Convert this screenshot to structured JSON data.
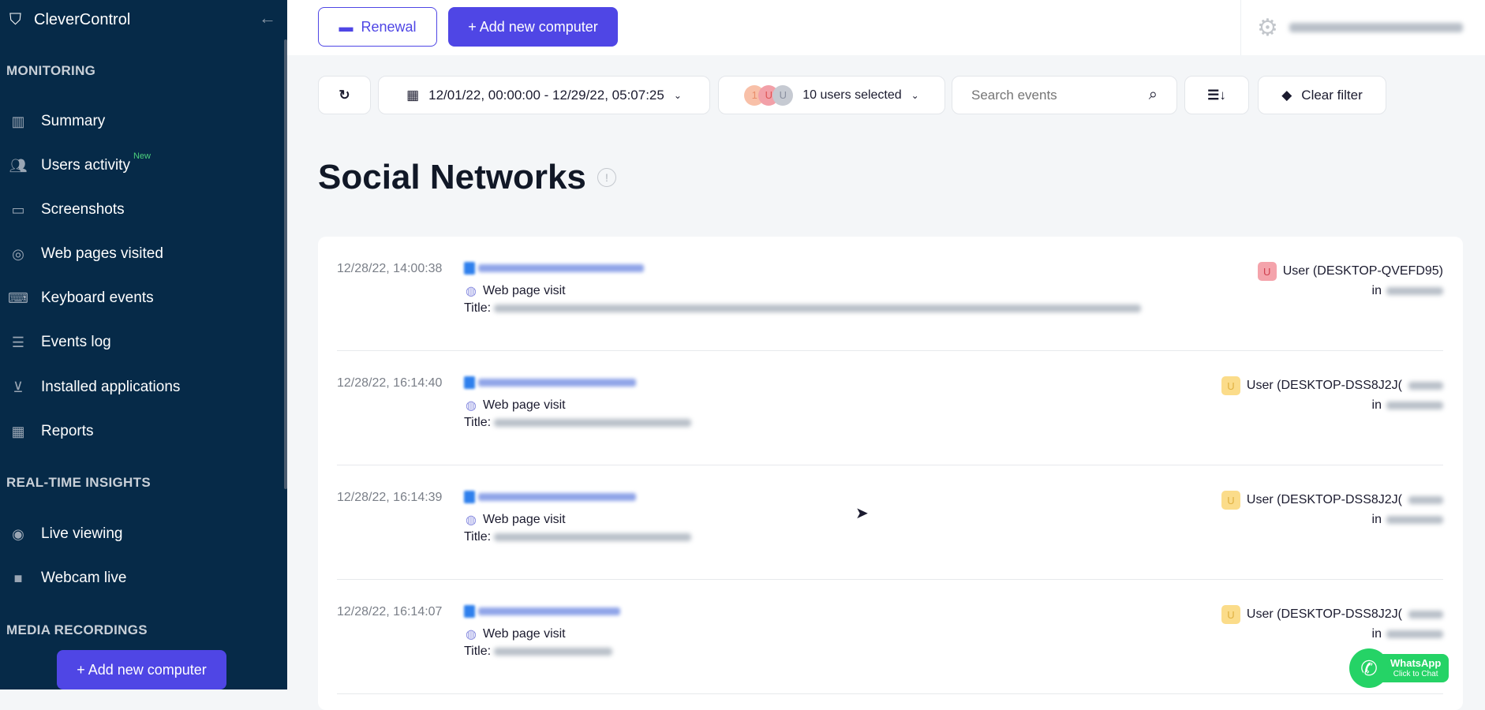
{
  "sidebar": {
    "brand": "CleverControl",
    "sections": {
      "monitoring": "MONITORING",
      "realtime": "REAL-TIME INSIGHTS",
      "media": "MEDIA RECORDINGS"
    },
    "items": [
      {
        "label": "Summary",
        "icon": "chart-icon"
      },
      {
        "label": "Users activity",
        "icon": "users-icon",
        "badge": "New"
      },
      {
        "label": "Screenshots",
        "icon": "monitor-icon"
      },
      {
        "label": "Web pages visited",
        "icon": "globe-icon"
      },
      {
        "label": "Keyboard events",
        "icon": "keyboard-icon"
      },
      {
        "label": "Events log",
        "icon": "list-icon"
      },
      {
        "label": "Installed applications",
        "icon": "install-icon"
      },
      {
        "label": "Reports",
        "icon": "grid-icon"
      },
      {
        "label": "Live viewing",
        "icon": "eye-icon"
      },
      {
        "label": "Webcam live",
        "icon": "camera-icon"
      }
    ],
    "add_button": "+ Add new computer"
  },
  "topbar": {
    "renewal": "Renewal",
    "add_computer": "+ Add new computer"
  },
  "filters": {
    "date_range": "12/01/22, 00:00:00 - 12/29/22, 05:07:25",
    "avatars": [
      "1",
      "U",
      "U"
    ],
    "users": "10 users selected",
    "search_placeholder": "Search events",
    "clear": "Clear filter"
  },
  "page": {
    "title": "Social Networks",
    "info": "!"
  },
  "events": [
    {
      "time": "12/28/22, 14:00:38",
      "type": "Web page visit",
      "title_label": "Title:",
      "user": "User (DESKTOP-QVEFD95)",
      "badge": "U",
      "badge_color": "#f4a3ab",
      "in": "in"
    },
    {
      "time": "12/28/22, 16:14:40",
      "type": "Web page visit",
      "title_label": "Title:",
      "user": "User (DESKTOP-DSS8J2J(",
      "badge": "U",
      "badge_color": "#fbdc8a",
      "in": "in"
    },
    {
      "time": "12/28/22, 16:14:39",
      "type": "Web page visit",
      "title_label": "Title:",
      "user": "User (DESKTOP-DSS8J2J(",
      "badge": "U",
      "badge_color": "#fbdc8a",
      "in": "in"
    },
    {
      "time": "12/28/22, 16:14:07",
      "type": "Web page visit",
      "title_label": "Title:",
      "user": "User (DESKTOP-DSS8J2J(",
      "badge": "U",
      "badge_color": "#fbdc8a",
      "in": "in"
    }
  ],
  "whatsapp": {
    "label": "WhatsApp",
    "sub": "Click to Chat"
  }
}
